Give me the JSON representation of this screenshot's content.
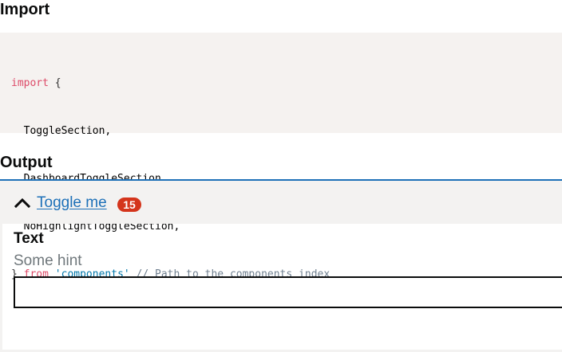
{
  "headings": {
    "import": "Import",
    "output": "Output"
  },
  "code": {
    "line1_kw": "import",
    "line1_rest": " {",
    "line2": "  ToggleSection,",
    "line3": "  DashboardToggleSection,",
    "line4": "  NoHighlightToggleSection,",
    "line5_open": "} ",
    "line5_kw": "from",
    "line5_space": " ",
    "line5_str": "'components'",
    "line5_comment": " // Path to the components index"
  },
  "toggle": {
    "label": "Toggle me",
    "count": "15",
    "expanded": true,
    "icon": "chevron-up-icon"
  },
  "field": {
    "label": "Text",
    "hint": "Some hint",
    "value": "",
    "placeholder": ""
  },
  "colors": {
    "link": "#1d70b8",
    "badge": "#d4351c",
    "panel": "#f3f2f1",
    "code_bg": "#f5f2f0",
    "keyword": "#dd4a68",
    "string": "#0077aa",
    "comment": "#708090"
  }
}
